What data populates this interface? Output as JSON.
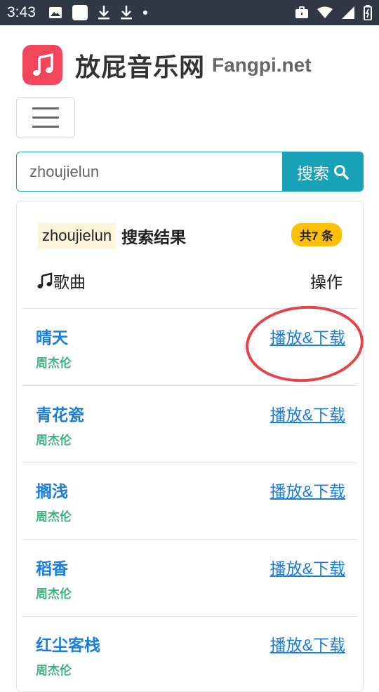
{
  "status_bar": {
    "time": "3:43"
  },
  "header": {
    "brand": "放屁音乐网",
    "brand_sub": "Fangpi.net"
  },
  "search": {
    "value": "zhoujielun",
    "button_label": "搜索"
  },
  "results": {
    "keyword": "zhoujielun",
    "title_suffix": "搜索结果",
    "count_badge": "共7 条",
    "col_song": "歌曲",
    "col_action": "操作",
    "items": [
      {
        "title": "晴天",
        "artist": "周杰伦",
        "action": "播放&下载"
      },
      {
        "title": "青花瓷",
        "artist": "周杰伦",
        "action": "播放&下载"
      },
      {
        "title": "搁浅",
        "artist": "周杰伦",
        "action": "播放&下载"
      },
      {
        "title": "稻香",
        "artist": "周杰伦",
        "action": "播放&下载"
      },
      {
        "title": "红尘客栈",
        "artist": "周杰伦",
        "action": "播放&下载"
      }
    ]
  },
  "colors": {
    "accent": "#17a2b8",
    "link": "#1a7de0",
    "artist": "#3fb27f",
    "badge": "#ffc107",
    "logo": "#f2465d",
    "annotation": "#e8414a"
  }
}
